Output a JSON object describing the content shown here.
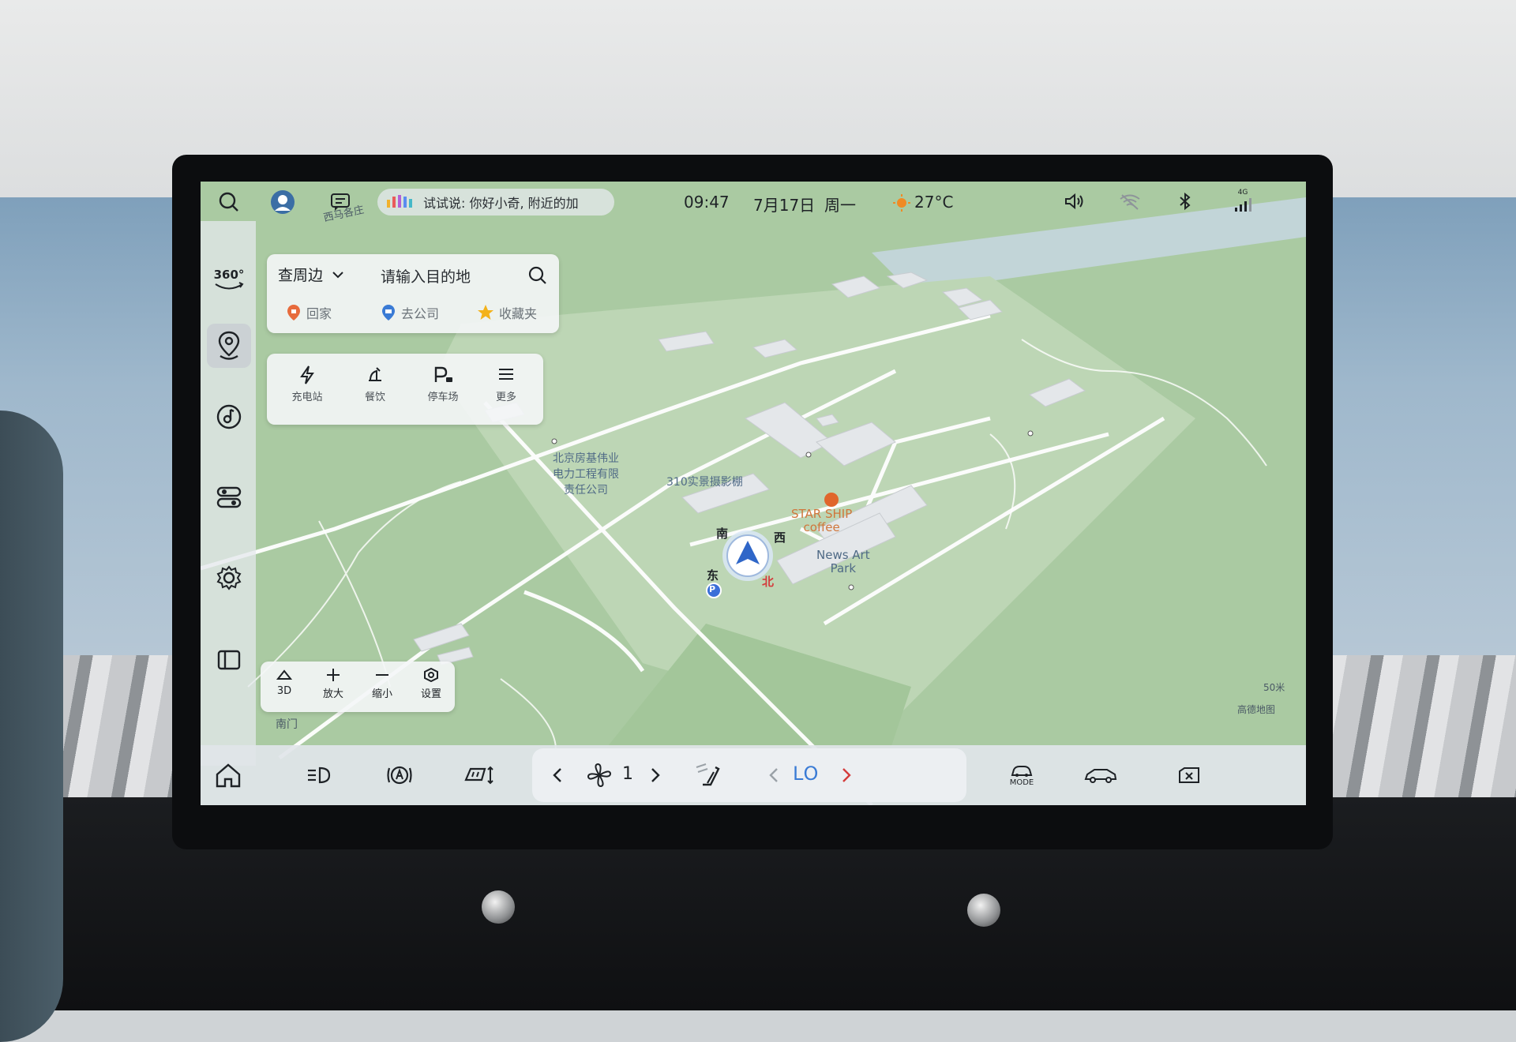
{
  "status": {
    "voice_hint": "试试说: 你好小奇, 附近的加",
    "time": "09:47",
    "date": "7月17日",
    "weekday": "周一",
    "temperature": "27°C",
    "signal_label": "4G"
  },
  "sidebar": {
    "items": [
      {
        "name": "360",
        "label": "360°"
      },
      {
        "name": "navigation"
      },
      {
        "name": "music"
      },
      {
        "name": "controls"
      },
      {
        "name": "settings"
      },
      {
        "name": "apps"
      }
    ]
  },
  "search_panel": {
    "nearby_label": "查周边",
    "destination_placeholder": "请输入目的地",
    "shortcuts": [
      {
        "label": "回家",
        "icon": "home-pin-icon",
        "color": "#e76b3c"
      },
      {
        "label": "去公司",
        "icon": "office-pin-icon",
        "color": "#3a7bd5"
      },
      {
        "label": "收藏夹",
        "icon": "star-icon",
        "color": "#f3b21b"
      }
    ]
  },
  "category_panel": {
    "items": [
      {
        "label": "充电站",
        "icon": "lightning-icon"
      },
      {
        "label": "餐饮",
        "icon": "restaurant-icon"
      },
      {
        "label": "停车场",
        "icon": "parking-icon"
      },
      {
        "label": "更多",
        "icon": "menu-icon"
      }
    ]
  },
  "map_controls": {
    "items": [
      {
        "label": "3D",
        "icon": "3d-icon"
      },
      {
        "label": "放大",
        "icon": "plus-icon"
      },
      {
        "label": "缩小",
        "icon": "minus-icon"
      },
      {
        "label": "设置",
        "icon": "settings-hex-icon"
      }
    ]
  },
  "map": {
    "labels": {
      "road_top": "西马各庄",
      "company": "北京房基伟业电力工程有限责任公司",
      "company_line1": "北京房基伟业",
      "company_line2": "电力工程有限",
      "company_line3": "责任公司",
      "studio": "310实景摄影棚",
      "coffee_line1": "STAR SHIP",
      "coffee_line2": "coffee",
      "park_line1": "News Art",
      "park_line2": "Park",
      "south_gate": "南门",
      "compass_s": "南",
      "compass_w": "西",
      "compass_e": "东",
      "compass_n": "北",
      "parking": "P"
    },
    "scale": "50米",
    "brand": "高德地图"
  },
  "bottom_bar": {
    "fan_level": "1",
    "temp_value": "LO",
    "mode_label": "MODE"
  },
  "colors": {
    "accent_blue": "#2f66c8",
    "red": "#d43c3c",
    "map_green": "#a9c9a3"
  }
}
